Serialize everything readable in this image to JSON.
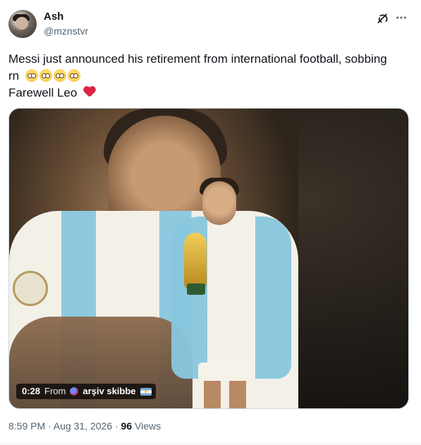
{
  "user": {
    "display_name": "Ash",
    "handle": "@mznstvr"
  },
  "tweet": {
    "line1": "Messi just announced his retirement from international football, sobbing",
    "line2_prefix": "rn",
    "line3": "Farewell Leo",
    "emojis": [
      "pleading-face",
      "pleading-face",
      "pleading-face",
      "pleading-face"
    ],
    "heart_emoji": "heart-with-ribbon"
  },
  "media": {
    "duration": "0:28",
    "from_label": "From",
    "source_name": "arşiv skibbe"
  },
  "meta": {
    "timestamp": "8:59 PM · Aug 31, 2026 ·",
    "views_count": "96",
    "views_label": "Views"
  },
  "icons": {
    "grok": "grok-icon",
    "more": "more-icon"
  }
}
